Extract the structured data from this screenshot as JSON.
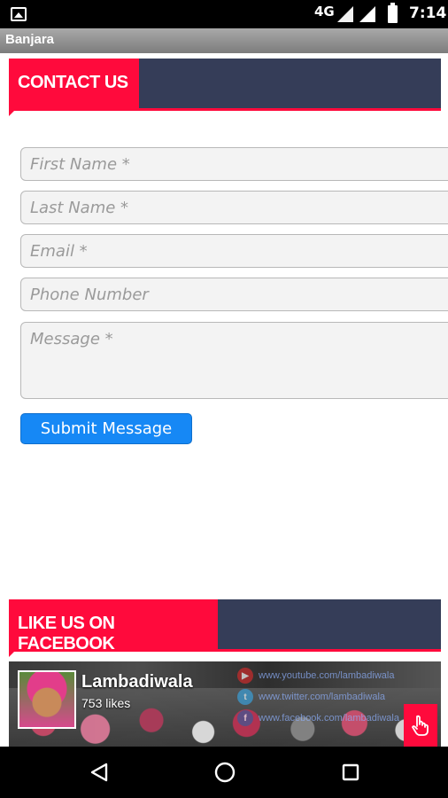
{
  "status_bar": {
    "network": "4G",
    "time": "7:14"
  },
  "app": {
    "title": "Banjara"
  },
  "contact_section": {
    "heading": "CONTACT US"
  },
  "form": {
    "first_name_placeholder": "First Name *",
    "last_name_placeholder": "Last Name *",
    "email_placeholder": "Email *",
    "phone_placeholder": "Phone Number",
    "message_placeholder": "Message *",
    "submit_label": "Submit Message"
  },
  "facebook_section": {
    "heading": "LIKE US ON FACEBOOK",
    "page_name": "Lambadiwala",
    "likes": "753 likes",
    "links": [
      {
        "icon": "youtube-icon",
        "text": "www.youtube.com/lambadiwala"
      },
      {
        "icon": "twitter-icon",
        "text": "www.twitter.com/lambadiwala"
      },
      {
        "icon": "facebook-icon",
        "text": "www.facebook.com/lambadiwala"
      }
    ]
  },
  "colors": {
    "accent_red": "#ff0a3c",
    "header_navy": "#353d58",
    "button_blue": "#1688f5"
  }
}
